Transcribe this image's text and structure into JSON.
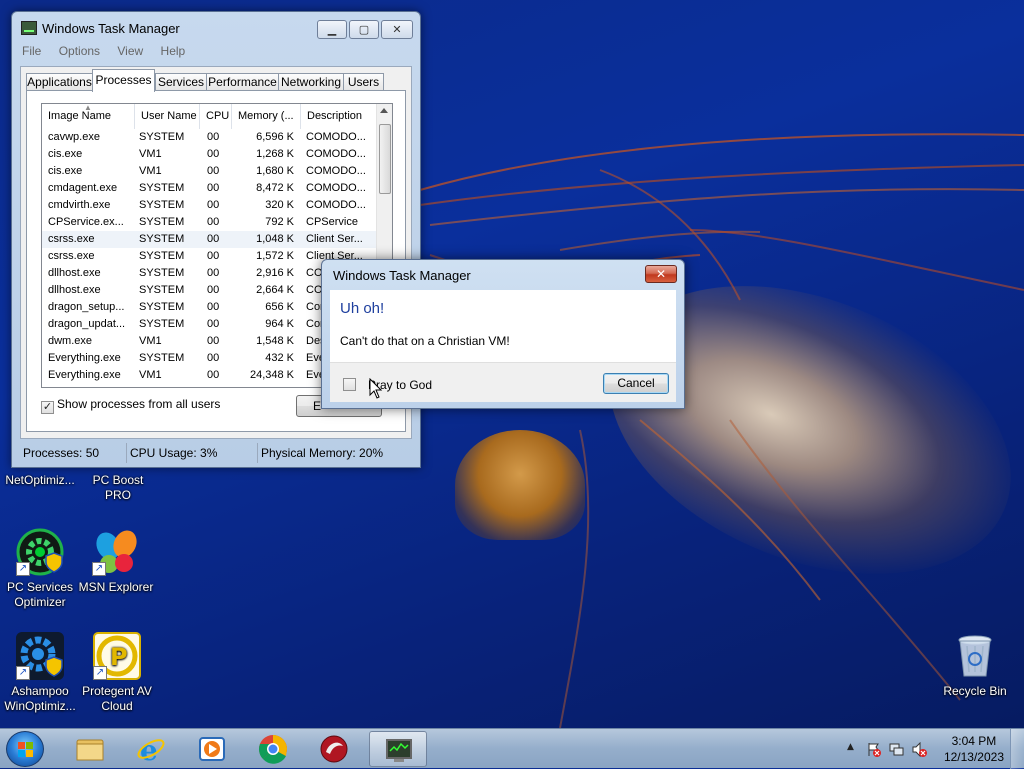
{
  "task_manager": {
    "title": "Windows Task Manager",
    "menu": [
      "File",
      "Options",
      "View",
      "Help"
    ],
    "tabs": [
      "Applications",
      "Processes",
      "Services",
      "Performance",
      "Networking",
      "Users"
    ],
    "active_tab": "Processes",
    "columns": [
      "Image Name",
      "User Name",
      "CPU",
      "Memory (...",
      "Description"
    ],
    "processes": [
      {
        "image": "cavwp.exe",
        "user": "SYSTEM",
        "cpu": "00",
        "mem": "6,596 K",
        "desc": "COMODO..."
      },
      {
        "image": "cis.exe",
        "user": "VM1",
        "cpu": "00",
        "mem": "1,268 K",
        "desc": "COMODO..."
      },
      {
        "image": "cis.exe",
        "user": "VM1",
        "cpu": "00",
        "mem": "1,680 K",
        "desc": "COMODO..."
      },
      {
        "image": "cmdagent.exe",
        "user": "SYSTEM",
        "cpu": "00",
        "mem": "8,472 K",
        "desc": "COMODO..."
      },
      {
        "image": "cmdvirth.exe",
        "user": "SYSTEM",
        "cpu": "00",
        "mem": "320 K",
        "desc": "COMODO..."
      },
      {
        "image": "CPService.ex...",
        "user": "SYSTEM",
        "cpu": "00",
        "mem": "792 K",
        "desc": "CPService"
      },
      {
        "image": "csrss.exe",
        "user": "SYSTEM",
        "cpu": "00",
        "mem": "1,048 K",
        "desc": "Client Ser..."
      },
      {
        "image": "csrss.exe",
        "user": "SYSTEM",
        "cpu": "00",
        "mem": "1,572 K",
        "desc": "Client Ser..."
      },
      {
        "image": "dllhost.exe",
        "user": "SYSTEM",
        "cpu": "00",
        "mem": "2,916 K",
        "desc": "CO"
      },
      {
        "image": "dllhost.exe",
        "user": "SYSTEM",
        "cpu": "00",
        "mem": "2,664 K",
        "desc": "CO"
      },
      {
        "image": "dragon_setup...",
        "user": "SYSTEM",
        "cpu": "00",
        "mem": "656 K",
        "desc": "Cor"
      },
      {
        "image": "dragon_updat...",
        "user": "SYSTEM",
        "cpu": "00",
        "mem": "964 K",
        "desc": "Cor"
      },
      {
        "image": "dwm.exe",
        "user": "VM1",
        "cpu": "00",
        "mem": "1,548 K",
        "desc": "Des"
      },
      {
        "image": "Everything.exe",
        "user": "SYSTEM",
        "cpu": "00",
        "mem": "432 K",
        "desc": "Eve"
      },
      {
        "image": "Everything.exe",
        "user": "VM1",
        "cpu": "00",
        "mem": "24,348 K",
        "desc": "Eve"
      }
    ],
    "show_all_label": "Show processes from all users",
    "show_all_checked": "✓",
    "end_process_label": "E",
    "status": {
      "processes": "Processes: 50",
      "cpu": "CPU Usage: 3%",
      "memory": "Physical Memory: 20%"
    }
  },
  "dialog": {
    "title": "Windows Task Manager",
    "close_glyph": "✕",
    "heading": "Uh oh!",
    "message": "Can't do that on a Christian VM!",
    "checkbox_label": "Pray to God",
    "cancel_label": "Cancel"
  },
  "desktop_icons": [
    {
      "label": "NetOptimiz..."
    },
    {
      "label": "PC Boost PRO"
    },
    {
      "label": "PC Services Optimizer"
    },
    {
      "label": "MSN Explorer"
    },
    {
      "label": "Ashampoo WinOptimiz..."
    },
    {
      "label": "Protegent  AV Cloud"
    },
    {
      "label": "Recycle Bin"
    }
  ],
  "taskbar": {
    "pinned": [
      "start-orb",
      "explorer-icon",
      "ie-icon",
      "media-player-icon",
      "chrome-icon",
      "comodo-icon",
      "task-manager-icon"
    ],
    "clock_time": "3:04 PM",
    "clock_date": "12/13/2023",
    "tray_arrow": "▲"
  },
  "colors": {
    "desktop_bg": "#0a2f9c",
    "dialog_heading": "#1e3f9e",
    "close_button": "#c0391f"
  }
}
